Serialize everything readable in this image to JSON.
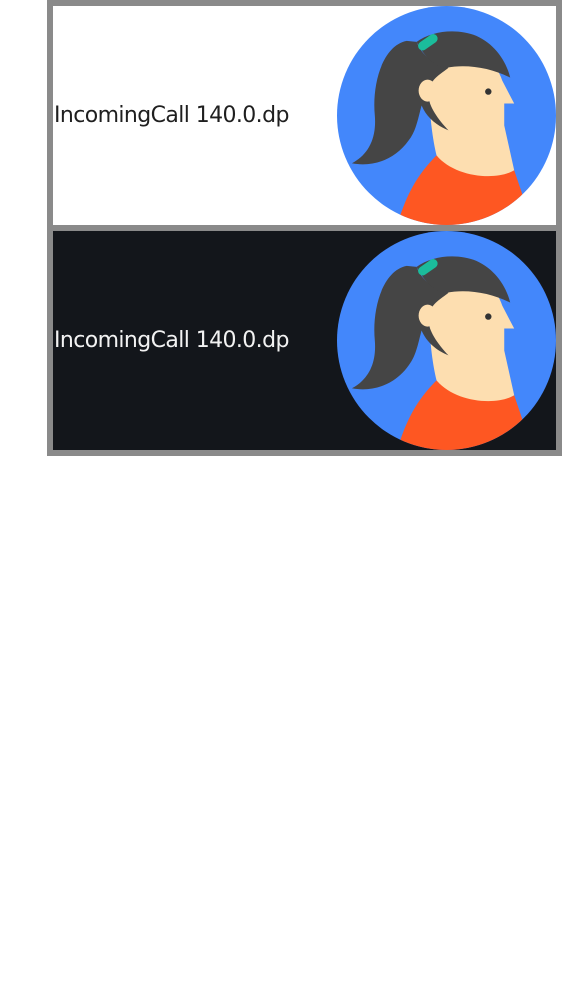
{
  "previews": [
    {
      "theme": "light",
      "label": "IncomingCall 140.0.dp",
      "background": "#ffffff",
      "text_color": "#1f1f1f"
    },
    {
      "theme": "dark",
      "label": "IncomingCall 140.0.dp",
      "background": "#13161b",
      "text_color": "#f2f2f2"
    }
  ],
  "colors": {
    "frame": "#8a8a8a",
    "avatar_circle": "#4387fb",
    "hair": "#454545",
    "skin": "#fddeb0",
    "shirt": "#fe5722",
    "hair_clip": "#1bbc9b"
  },
  "avatar_icon": "woman-with-ponytail-avatar"
}
